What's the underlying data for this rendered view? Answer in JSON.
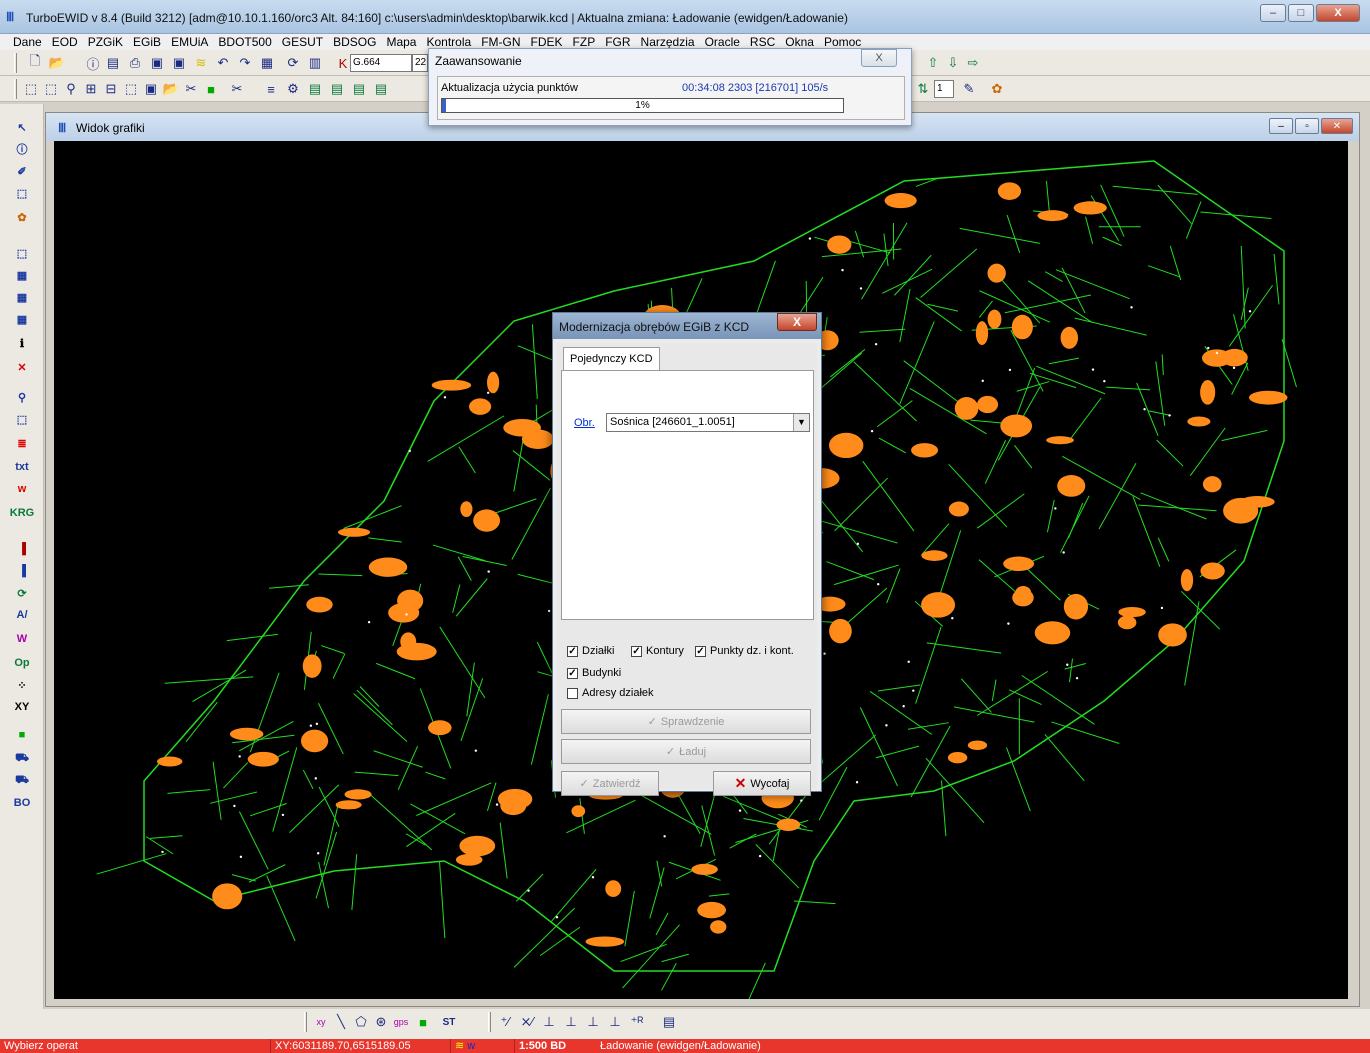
{
  "window": {
    "title": "TurboEWID v 8.4 (Build 3212) [adm@10.10.1.160/orc3 Alt. 84:160]  c:\\users\\admin\\desktop\\barwik.kcd | Aktualna zmiana: Ładowanie (ewidgen/Ładowanie)",
    "minimize": "–",
    "maximize": "□",
    "close": "X"
  },
  "menu": [
    "Dane",
    "EOD",
    "PZGiK",
    "EGiB",
    "EMUiA",
    "BDOT500",
    "GESUT",
    "BDSOG",
    "Mapa",
    "Kontrola",
    "FM-GN",
    "FDEK",
    "FZP",
    "FGR",
    "Narzędzia",
    "Oracle",
    "RSC",
    "Okna",
    "Pomoc"
  ],
  "toolbar": {
    "code_value": "G.664",
    "code_value2": "22",
    "scale_value": "1"
  },
  "left_toolbar": {
    "txt": "txt",
    "w": "w",
    "krg": "KRG",
    "op": "Op",
    "xy": "XY",
    "bo": "BO"
  },
  "progress": {
    "title": "Zaawansowanie",
    "close": "X",
    "label": "Aktualizacja użycia punktów",
    "stats": "00:34:08  2303 [216701]  105/s",
    "percent_text": "1%",
    "percent": 0.01
  },
  "graphics_window": {
    "title": "Widok grafiki"
  },
  "dialog": {
    "title": "Modernizacja obrębów EGiB z KCD",
    "close": "X",
    "tab": "Pojedynczy KCD",
    "obr_label": "Obr.",
    "obr_value": "Sośnica [246601_1.0051]",
    "checks": [
      {
        "label": "Działki",
        "checked": true
      },
      {
        "label": "Kontury",
        "checked": true
      },
      {
        "label": "Punkty dz. i kont.",
        "checked": true
      },
      {
        "label": "Budynki",
        "checked": true
      },
      {
        "label": "Adresy działek",
        "checked": false
      }
    ],
    "btn_check": "Sprawdzenie",
    "btn_load": "Ładuj",
    "btn_confirm": "Zatwierdź",
    "btn_cancel": "Wycofaj"
  },
  "bottom_toolbar": {
    "st": "ST"
  },
  "status": {
    "left": "Wybierz operat",
    "coords": "XY:6031189.70,6515189.05",
    "layer": "w",
    "scale": "1:500 BD",
    "change": "Ładowanie (ewidgen/Ładowanie)"
  },
  "colors": {
    "parcel_lines": "#22dd22",
    "buildings": "#ff8c1a",
    "status_bar": "#e8362d",
    "map_bg": "#000000"
  }
}
